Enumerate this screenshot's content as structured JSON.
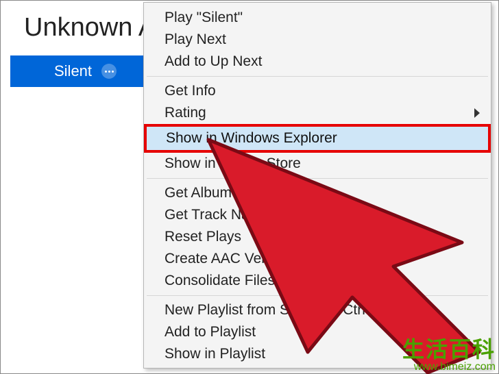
{
  "header": {
    "title": "Unknown A"
  },
  "track": {
    "name": "Silent",
    "more_label": "…"
  },
  "menu": {
    "group1": [
      {
        "label": "Play \"Silent\""
      },
      {
        "label": "Play Next"
      },
      {
        "label": "Add to Up Next"
      }
    ],
    "group2": [
      {
        "label": "Get Info"
      },
      {
        "label": "Rating",
        "submenu": true
      }
    ],
    "highlighted": {
      "label": "Show in Windows Explorer"
    },
    "group3": [
      {
        "label": "Show in iTunes Store"
      }
    ],
    "group4": [
      {
        "label": "Get Album Artwork"
      },
      {
        "label": "Get Track Names"
      },
      {
        "label": "Reset Plays"
      },
      {
        "label": "Create AAC Version"
      },
      {
        "label": "Consolidate Files..."
      }
    ],
    "group5": [
      {
        "label": "New Playlist from Selection            Ctrl+Shift+N"
      },
      {
        "label": "Add to Playlist"
      },
      {
        "label": "Show in Playlist"
      }
    ]
  },
  "watermark": {
    "text": "生活百科",
    "url": "www.bimeiz.com"
  }
}
